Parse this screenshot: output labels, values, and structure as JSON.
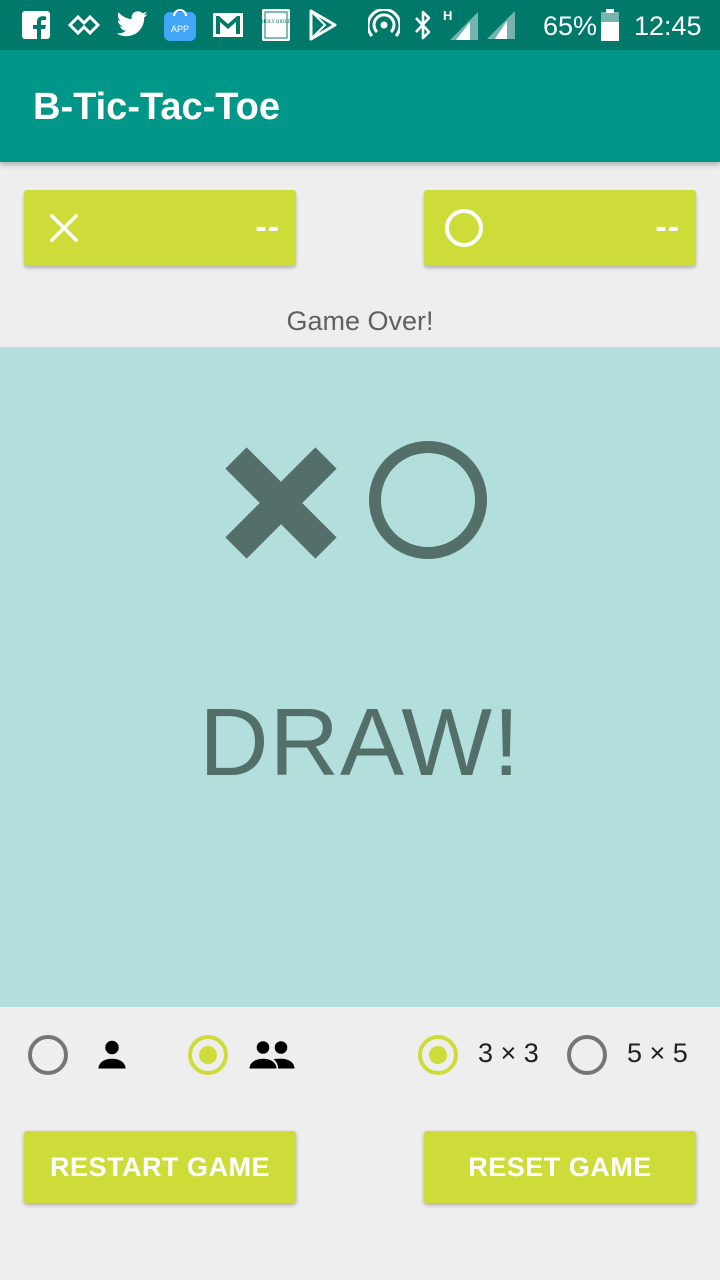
{
  "status_bar": {
    "battery": "65%",
    "time": "12:45",
    "icons": [
      "facebook-icon",
      "cloud-link-icon",
      "twitter-icon",
      "app-store-icon",
      "gmail-icon",
      "holy-bible-icon",
      "play-store-icon",
      "hotspot-icon",
      "bluetooth-icon",
      "signal-h-icon",
      "signal-icon",
      "battery-icon"
    ],
    "bible_icon_text": "HOLY BIBLE",
    "app_icon_text": "APP",
    "network_type": "H"
  },
  "app_bar": {
    "title": "B-Tic-Tac-Toe"
  },
  "scores": {
    "x": {
      "icon": "x-mark-icon",
      "value": "--"
    },
    "o": {
      "icon": "o-mark-icon",
      "value": "--"
    }
  },
  "game_status": "Game Over!",
  "result": {
    "icons": [
      "x-mark-icon",
      "o-mark-icon"
    ],
    "text": "DRAW!"
  },
  "options": {
    "players": [
      {
        "icon": "single-player-icon",
        "selected": false
      },
      {
        "icon": "two-players-icon",
        "selected": true
      }
    ],
    "board_size": [
      {
        "label": "3 × 3",
        "selected": true
      },
      {
        "label": "5 × 5",
        "selected": false
      }
    ]
  },
  "buttons": {
    "restart": "RESTART GAME",
    "reset": "RESET GAME"
  },
  "colors": {
    "status_bar": "#00796b",
    "app_bar": "#009688",
    "accent": "#cddc39",
    "board": "#b2dfdb",
    "result_mark": "#546e6a",
    "background": "#eeeeee"
  }
}
